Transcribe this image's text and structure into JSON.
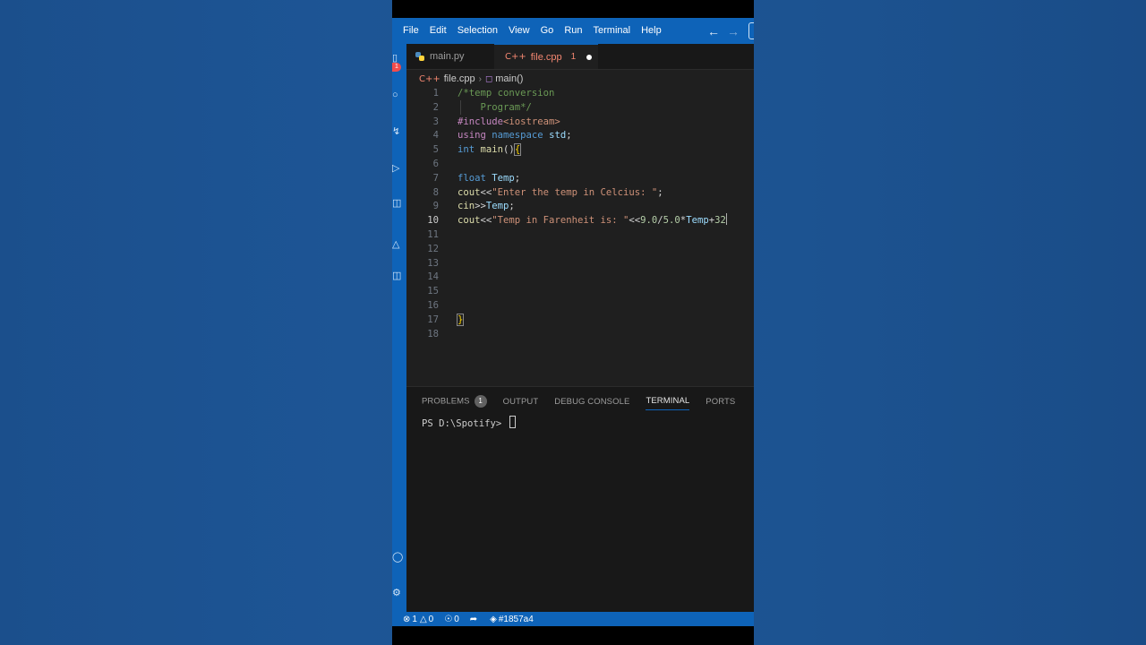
{
  "menubar": {
    "items": [
      "File",
      "Edit",
      "Selection",
      "View",
      "Go",
      "Run",
      "Terminal",
      "Help"
    ]
  },
  "activity_bar": {
    "badge": "1"
  },
  "tabs": [
    {
      "label": "main.py",
      "icon": "python-icon"
    },
    {
      "label": "file.cpp",
      "icon": "cpp-icon",
      "problems": "1"
    }
  ],
  "breadcrumb": {
    "file": "file.cpp",
    "symbol": "main()"
  },
  "editor": {
    "line_numbers": [
      "1",
      "2",
      "3",
      "4",
      "5",
      "6",
      "7",
      "8",
      "9",
      "10",
      "11",
      "12",
      "13",
      "14",
      "15",
      "16",
      "17",
      "18"
    ],
    "active_line": "10",
    "lines": [
      {
        "n": "1",
        "parts": [
          [
            "c",
            "/*temp conversion"
          ]
        ]
      },
      {
        "n": "2",
        "parts": [
          [
            "c",
            "    Program*/"
          ]
        ]
      },
      {
        "n": "3",
        "parts": [
          [
            "p",
            "#include"
          ],
          [
            "s",
            "<iostream>"
          ]
        ]
      },
      {
        "n": "4",
        "parts": [
          [
            "p",
            "using"
          ],
          [
            "w",
            " "
          ],
          [
            "k",
            "namespace"
          ],
          [
            "w",
            " "
          ],
          [
            "v",
            "std"
          ],
          [
            "w",
            ";"
          ]
        ]
      },
      {
        "n": "5",
        "parts": [
          [
            "k",
            "int"
          ],
          [
            "w",
            " "
          ],
          [
            "f",
            "main"
          ],
          [
            "w",
            "()"
          ],
          [
            "b",
            "{"
          ]
        ]
      },
      {
        "n": "6",
        "parts": []
      },
      {
        "n": "7",
        "parts": [
          [
            "k",
            "float"
          ],
          [
            "w",
            " "
          ],
          [
            "v",
            "Temp"
          ],
          [
            "w",
            ";"
          ]
        ]
      },
      {
        "n": "8",
        "parts": [
          [
            "f",
            "cout"
          ],
          [
            "w",
            "<<"
          ],
          [
            "s",
            "\"Enter the temp in Celcius: \""
          ],
          [
            "w",
            ";"
          ]
        ]
      },
      {
        "n": "9",
        "parts": [
          [
            "f",
            "cin"
          ],
          [
            "w",
            ">>"
          ],
          [
            "v",
            "Temp"
          ],
          [
            "w",
            ";"
          ]
        ]
      },
      {
        "n": "10",
        "parts": [
          [
            "f",
            "cout"
          ],
          [
            "w",
            "<<"
          ],
          [
            "s",
            "\"Temp in Farenheit is: \""
          ],
          [
            "w",
            "<<"
          ],
          [
            "m",
            "9.0"
          ],
          [
            "w",
            "/"
          ],
          [
            "m",
            "5.0"
          ],
          [
            "w",
            "*"
          ],
          [
            "v",
            "Temp"
          ],
          [
            "w",
            "+"
          ],
          [
            "m",
            "32"
          ]
        ]
      },
      {
        "n": "11",
        "parts": []
      },
      {
        "n": "12",
        "parts": []
      },
      {
        "n": "13",
        "parts": []
      },
      {
        "n": "14",
        "parts": []
      },
      {
        "n": "15",
        "parts": []
      },
      {
        "n": "16",
        "parts": []
      },
      {
        "n": "17",
        "parts": [
          [
            "b",
            "}"
          ]
        ]
      },
      {
        "n": "18",
        "parts": []
      }
    ]
  },
  "panel": {
    "tabs": [
      "PROBLEMS",
      "OUTPUT",
      "DEBUG CONSOLE",
      "TERMINAL",
      "PORTS"
    ],
    "problems_count": "1",
    "active_tab": "TERMINAL",
    "terminal_prompt": "PS D:\\Spotify> "
  },
  "statusbar": {
    "errors": "1",
    "warnings": "0",
    "ports": "0",
    "commit": "#1857a4"
  }
}
